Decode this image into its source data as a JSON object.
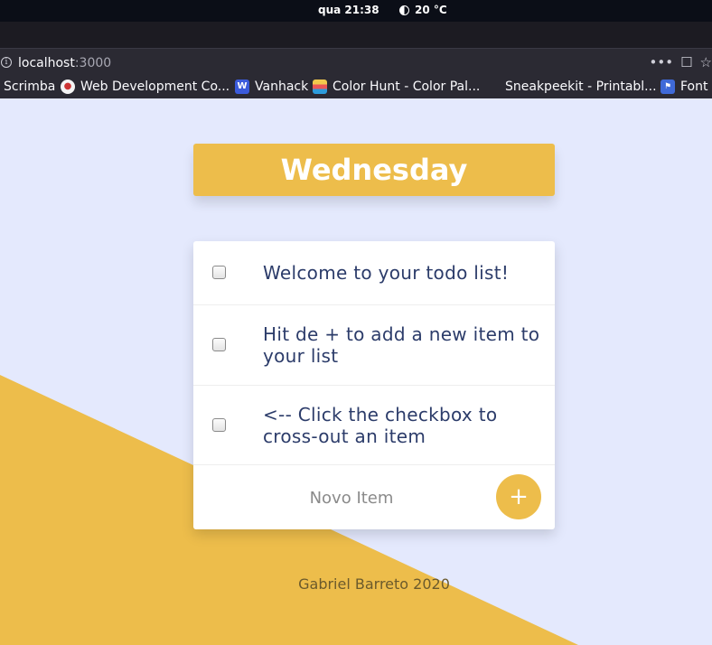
{
  "os": {
    "clock": "qua 21:38",
    "weather": "20 °C"
  },
  "browser": {
    "url_host": "localhost",
    "url_port": ":3000",
    "actions": [
      "•••",
      "☐",
      "☆"
    ],
    "bookmarks": [
      {
        "label": "Scrimba",
        "icon": ""
      },
      {
        "label": "Web Development Co...",
        "icon": "chrome-icon"
      },
      {
        "label": "Vanhack",
        "icon": "vanhack-icon"
      },
      {
        "label": "Color Hunt - Color Pal...",
        "icon": "colorhunt-icon"
      },
      {
        "label": "Sneakpeekit - Printabl...",
        "icon": ""
      },
      {
        "label": "Font A",
        "icon": "fontawesome-icon"
      }
    ]
  },
  "app": {
    "heading": "Wednesday",
    "items": [
      "Welcome to your todo list!",
      "Hit de + to add a new item to your list",
      "<-- Click the checkbox to cross-out an item"
    ],
    "new_item_placeholder": "Novo Item",
    "add_button": "+",
    "footer": "Gabriel Barreto 2020"
  },
  "colors": {
    "accent": "#EDBD4B",
    "background": "#E4E9FD",
    "text": "#2c3c6a"
  }
}
